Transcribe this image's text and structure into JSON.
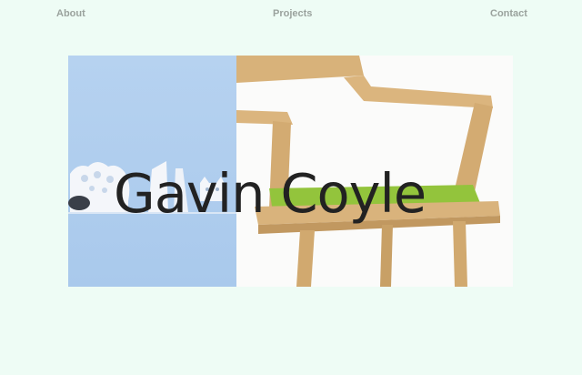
{
  "nav": {
    "about": "About",
    "projects": "Projects",
    "contact": "Contact"
  },
  "hero": {
    "title": "Gavin Coyle"
  },
  "colors": {
    "page_bg": "#eefcf5",
    "nav_text": "#9aa29d",
    "title_text": "#222222",
    "left_panel_bg": "#b0cdee",
    "chair_wood": "#d9b37c",
    "seat_cushion": "#8fc23a"
  }
}
